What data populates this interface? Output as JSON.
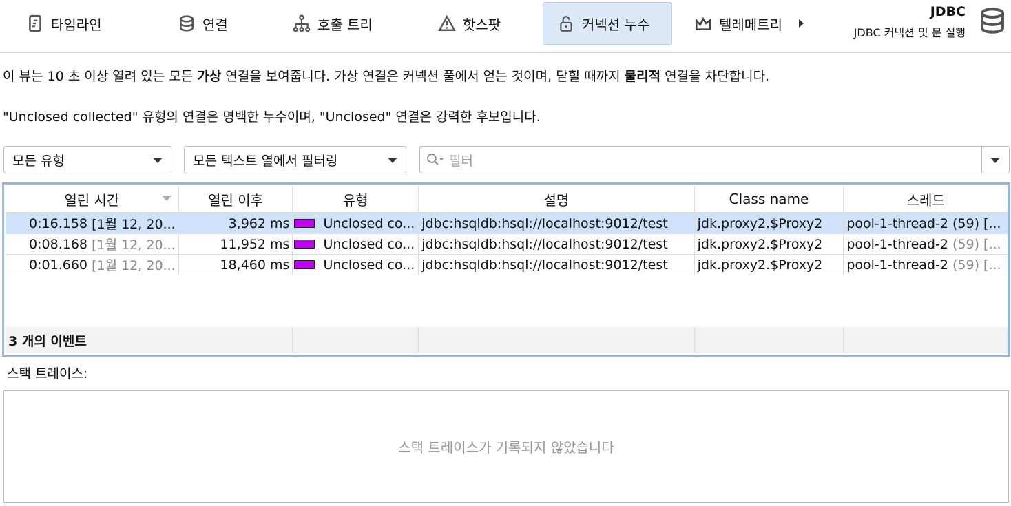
{
  "tabs": [
    {
      "label": "타임라인",
      "icon": "timeline-icon"
    },
    {
      "label": "연결",
      "icon": "database-icon"
    },
    {
      "label": "호출 트리",
      "icon": "call-tree-icon"
    },
    {
      "label": "핫스팟",
      "icon": "warning-icon"
    },
    {
      "label": "커넥션 누수",
      "icon": "lock-icon",
      "active": true
    },
    {
      "label": "텔레메트리",
      "icon": "telemetry-icon"
    }
  ],
  "header": {
    "title": "JDBC",
    "subtitle": "JDBC 커넥션 및 문 실행"
  },
  "description": {
    "line1": [
      "이 뷰는 10 초 이상 열려 있는 모든 ",
      "가상",
      " 연결을 보여줍니다. 가상 연결은 커넥션 풀에서 얻는 것이며, 닫힐 때까지 ",
      "물리적",
      " 연결을 차단합니다."
    ],
    "line2": "\"Unclosed collected\" 유형의 연결은 명백한 누수이며, \"Unclosed\" 연결은 강력한 후보입니다."
  },
  "filters": {
    "type_select": "모든 유형",
    "column_select": "모든 텍스트 열에서 필터링",
    "filter_placeholder": "필터"
  },
  "table": {
    "columns": [
      "열린 시간",
      "열린 이후",
      "유형",
      "설명",
      "Class name",
      "스레드"
    ],
    "rows": [
      {
        "time": "0:16.158",
        "date": "[1월 12, 20...",
        "since": "3,962 ms",
        "type": "Unclosed co...",
        "desc": "jdbc:hsqldb:hsql://localhost:9012/test",
        "class": "jdk.proxy2.$Proxy2",
        "thread": "pool-1-thread-2",
        "thread_id": "(59) [...",
        "selected": true
      },
      {
        "time": "0:08.168",
        "date": "[1월 12, 20...",
        "since": "11,952 ms",
        "type": "Unclosed co...",
        "desc": "jdbc:hsqldb:hsql://localhost:9012/test",
        "class": "jdk.proxy2.$Proxy2",
        "thread": "pool-1-thread-2",
        "thread_id": "(59) [..."
      },
      {
        "time": "0:01.660",
        "date": "[1월 12, 20...",
        "since": "18,460 ms",
        "type": "Unclosed co...",
        "desc": "jdbc:hsqldb:hsql://localhost:9012/test",
        "class": "jdk.proxy2.$Proxy2",
        "thread": "pool-1-thread-2",
        "thread_id": "(59) [..."
      }
    ],
    "footer": "3 개의 이벤트",
    "type_color": "#c000f0"
  },
  "stack": {
    "label": "스택 트레이스:",
    "empty": "스택 트레이스가 기록되지 않았습니다"
  }
}
